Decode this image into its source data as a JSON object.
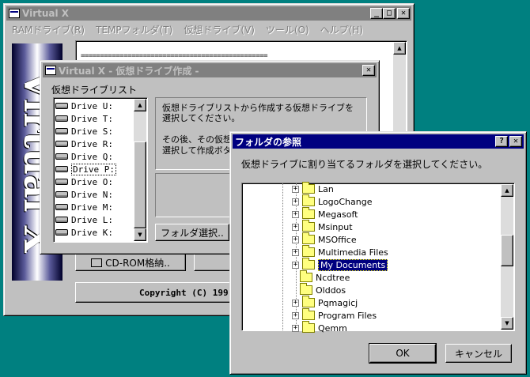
{
  "main_window": {
    "title": "Virtual X",
    "banner_text": "Virtual X",
    "menu": [
      "RAMドライブ(R)",
      "TEMPフォルダ(T)",
      "仮想ドライブ(V)",
      "ツール(O)",
      "ヘルプ(H)"
    ],
    "text_area_line": "================================================",
    "cdrom_button": "CD-ROM格納..",
    "copyright": "Copyright (C) 199"
  },
  "create_dialog": {
    "title": "Virtual X - 仮想ドライブ作成 -",
    "list_label": "仮想ドライブリスト",
    "drives": [
      "Drive U:",
      "Drive T:",
      "Drive S:",
      "Drive R:",
      "Drive Q:",
      "Drive P:",
      "Drive O:",
      "Drive N:",
      "Drive M:",
      "Drive L:",
      "Drive K:"
    ],
    "selected_drive": "Drive P:",
    "instruction_1": "仮想ドライブリストから作成する仮想ドライブを選択してください。",
    "instruction_2": "その後、その仮想",
    "instruction_3": "選択して作成ボタ",
    "folder_select_button": "フォルダ選択..",
    "close_glyph": "✕"
  },
  "browse_dialog": {
    "title": "フォルダの参照",
    "prompt": "仮想ドライブに割り当てるフォルダを選択してください。",
    "folders": [
      {
        "name": "Lan",
        "expandable": true
      },
      {
        "name": "LogoChange",
        "expandable": true
      },
      {
        "name": "Megasoft",
        "expandable": true
      },
      {
        "name": "Msinput",
        "expandable": true
      },
      {
        "name": "MSOffice",
        "expandable": true
      },
      {
        "name": "Multimedia Files",
        "expandable": true
      },
      {
        "name": "My Documents",
        "expandable": true
      },
      {
        "name": "Ncdtree",
        "expandable": false
      },
      {
        "name": "Olddos",
        "expandable": false
      },
      {
        "name": "Pqmagicj",
        "expandable": true
      },
      {
        "name": "Program Files",
        "expandable": true
      },
      {
        "name": "Qemm",
        "expandable": true
      }
    ],
    "selected_folder": "My Documents",
    "ok_label": "OK",
    "cancel_label": "キャンセル",
    "help_glyph": "?",
    "close_glyph": "✕"
  }
}
